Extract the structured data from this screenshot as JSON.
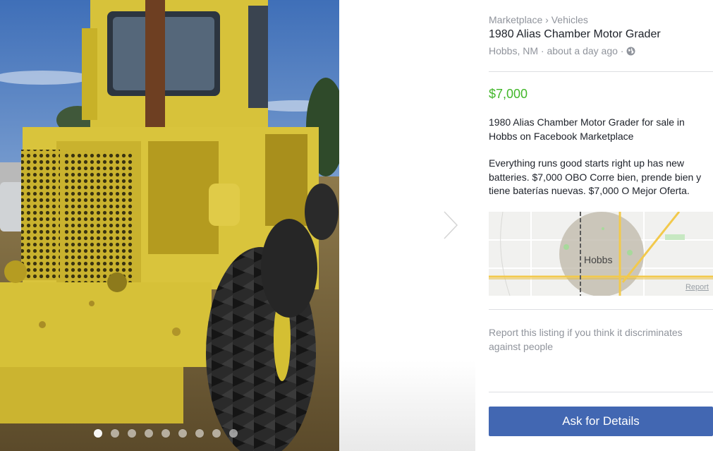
{
  "breadcrumb": [
    "Marketplace",
    "Vehicles"
  ],
  "breadcrumb_separator": "›",
  "listing": {
    "title": "1980 Alias Chamber Motor Grader",
    "location": "Hobbs, NM",
    "time": "about a day ago",
    "meta_separator": "·",
    "price": "$7,000",
    "price_color": "#42b72a",
    "description_1": "1980 Alias Chamber Motor Grader for sale in Hobbs on Facebook Marketplace",
    "description_2": "Everything runs good starts right up has new batteries. $7,000 OBO Corre bien, prende bien y tiene baterías nuevas. $7,000 O Mejor Oferta."
  },
  "map": {
    "city": "Hobbs",
    "report_link": "Report"
  },
  "report_listing": "Report this listing if you think it discriminates against people",
  "ask_button": "Ask for Details",
  "ask_button_color": "#4267b2",
  "gallery": {
    "photo_count": 9,
    "active_index": 0
  },
  "icons": {
    "privacy": "globe-icon",
    "next": "chevron-right-icon"
  }
}
